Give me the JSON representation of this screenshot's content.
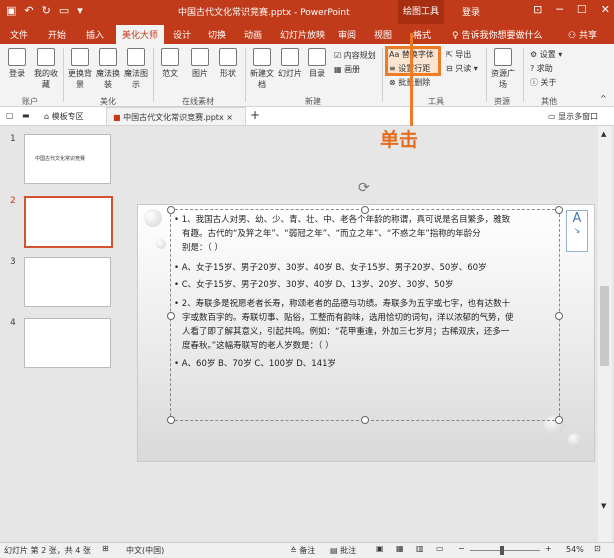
{
  "titlebar": {
    "title": "中国古代文化常识竞赛.pptx - PowerPoint",
    "context_tab": "绘图工具",
    "login": "登录",
    "restore_icon": "ribbon-display-options-icon"
  },
  "tabs": [
    "文件",
    "开始",
    "插入",
    "美化大师",
    "设计",
    "切换",
    "动画",
    "幻灯片放映",
    "审阅",
    "视图",
    "格式"
  ],
  "tell_me": "告诉我你想要做什么",
  "share": "共享",
  "ribbon": {
    "account": {
      "login": "登录",
      "fav": "我的收藏",
      "group": "账户"
    },
    "beautify": {
      "change_bg": "更换背景",
      "magic_change": "魔法换装",
      "magic_diagram": "魔法图示",
      "group": "美化"
    },
    "online": {
      "template": "范文",
      "image": "图片",
      "shape": "形状",
      "group": "在线素材"
    },
    "new": {
      "new_doc": "新建文档",
      "slides": "幻灯片",
      "toc": "目录",
      "content_plan": "内容规划",
      "album": "画册",
      "group": "新建"
    },
    "tools": {
      "replace_font": "替换字体",
      "row_spacing": "设置行距",
      "export": "导出",
      "save": "只读",
      "batch_delete": "批量删除",
      "group": "工具"
    },
    "resources": {
      "resource_plaza": "资源广场",
      "group": "资源"
    },
    "other": {
      "settings": "设置",
      "help": "求助",
      "about": "关于",
      "group": "其他"
    }
  },
  "docbar": {
    "template_zone": "模板专区",
    "current_doc": "中国古代文化常识竞赛.pptx",
    "show_multi": "显示多窗口"
  },
  "annotation": "单击",
  "thumbnails": [
    {
      "num": "1",
      "title": "中国古代文化常识竞赛"
    },
    {
      "num": "2"
    },
    {
      "num": "3"
    },
    {
      "num": "4"
    }
  ],
  "slide": {
    "lines": [
      "• 1、我国古人对男、幼、少、青、壮、中、老各个年龄的称谓，真可说是名目繁多，雅致",
      "有趣。古代的“及笄之年”、“弱冠之年”、“而立之年”、“不惑之年”指称的年龄分",
      "别是：（ ）",
      "• A、女子15岁、男子20岁、30岁、40岁          B、女子15岁、男子20岁、50岁、60岁",
      "• C、女子15岁、男子20岁、30岁、40岁          D、13岁、20岁、30岁、50岁",
      "• 2、寿联多是祝愿老者长寿，称颂老者的品德与功绩。寿联多为五字或七字，也有达数十",
      "字或数百字的。寿联切事、贴俗，工整而有韵味，选用恰切的词句，洋以浓郁的气势，使",
      "人看了即了解其意义，引起共鸣。例如：“花甲重逢，外加三七岁月；古稀双庆，还多一",
      "度春秋。”这幅寿联写的老人岁数是：（ ）",
      "• A、60岁          B、70岁          C、100岁          D、141岁"
    ]
  },
  "status": {
    "slide_info": "幻灯片 第 2 张，共 4 张",
    "language": "中文(中国)",
    "notes": "备注",
    "comments": "批注",
    "zoom": "54%"
  },
  "colors": {
    "accent": "#c13b1b",
    "highlight": "#ef7c25"
  }
}
